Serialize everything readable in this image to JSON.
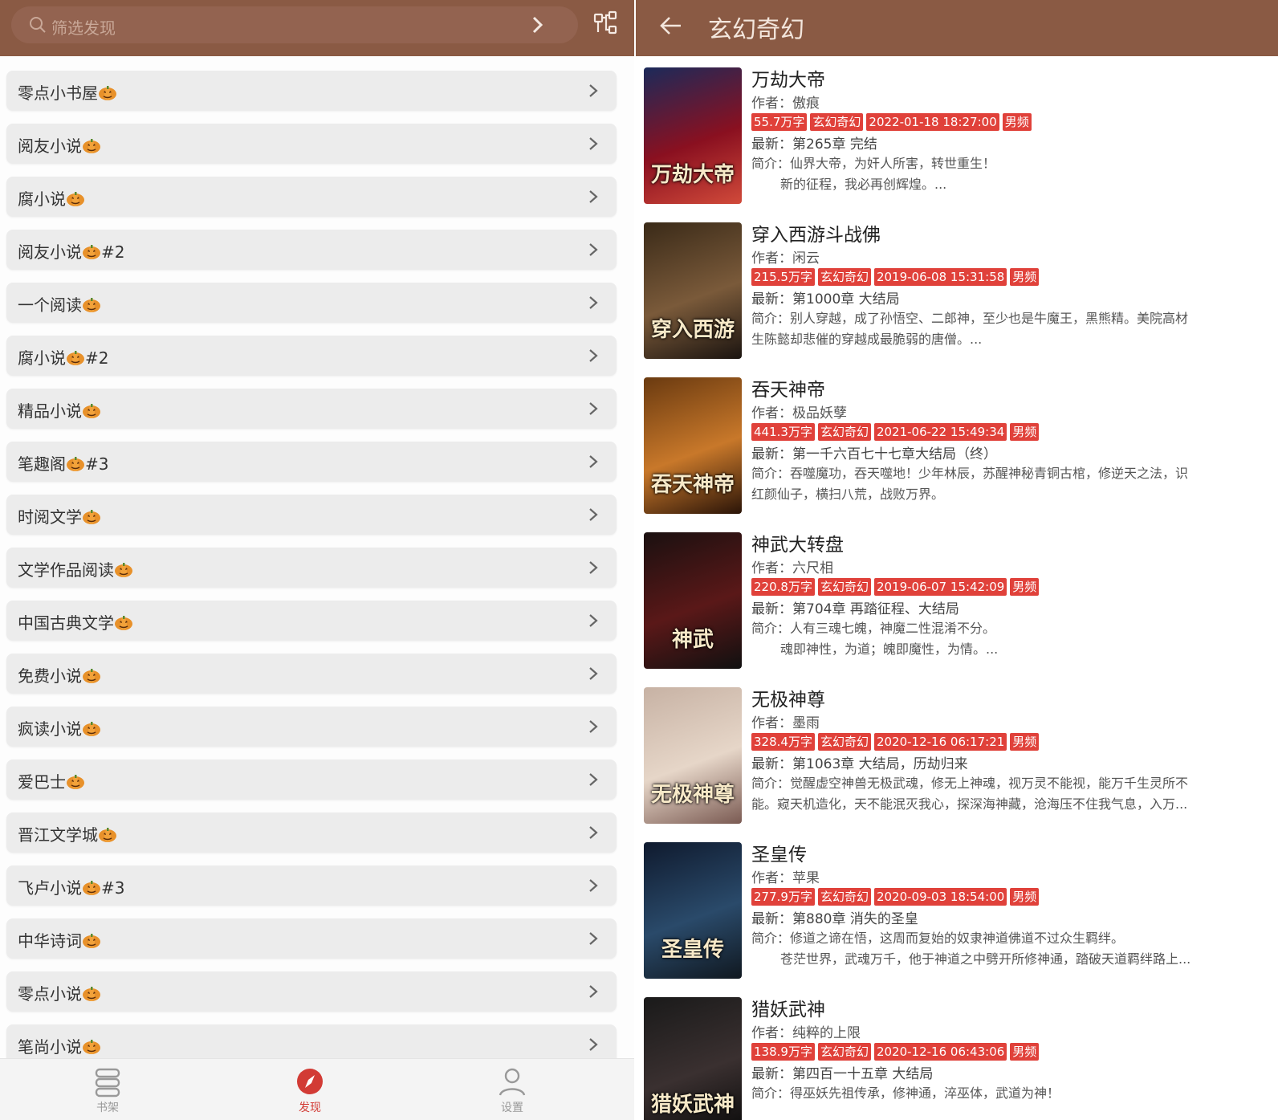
{
  "left": {
    "search_placeholder": "筛选发现",
    "sources": [
      {
        "name": "零点小书屋",
        "suffix": ""
      },
      {
        "name": "阅友小说",
        "suffix": ""
      },
      {
        "name": "腐小说",
        "suffix": ""
      },
      {
        "name": "阅友小说",
        "suffix": "#2"
      },
      {
        "name": "一个阅读",
        "suffix": ""
      },
      {
        "name": "腐小说",
        "suffix": "#2"
      },
      {
        "name": "精品小说",
        "suffix": ""
      },
      {
        "name": "笔趣阁",
        "suffix": "#3"
      },
      {
        "name": "时阅文学",
        "suffix": ""
      },
      {
        "name": "文学作品阅读",
        "suffix": ""
      },
      {
        "name": "中国古典文学",
        "suffix": ""
      },
      {
        "name": "免费小说",
        "suffix": ""
      },
      {
        "name": "疯读小说",
        "suffix": ""
      },
      {
        "name": "爱巴士",
        "suffix": ""
      },
      {
        "name": "晋江文学城",
        "suffix": ""
      },
      {
        "name": "飞卢小说",
        "suffix": "#3"
      },
      {
        "name": "中华诗词",
        "suffix": ""
      },
      {
        "name": "零点小说",
        "suffix": ""
      },
      {
        "name": "笔尚小说",
        "suffix": ""
      }
    ],
    "nav": {
      "bookshelf": "书架",
      "discover": "发现",
      "settings": "设置"
    },
    "accent": "#8a5a44",
    "active_color": "#d23b35"
  },
  "right": {
    "title": "玄幻奇幻",
    "tag_color": "#e0413a",
    "books": [
      {
        "name": "万劫大帝",
        "author": "作者：傲痕",
        "words": "55.7万字",
        "category": "玄幻奇幻",
        "updated": "2022-01-18 18:27:00",
        "channel": "男频",
        "latest": "最新：第265章 完结",
        "intro1": "简介：仙界大帝，为奸人所害，转世重生！",
        "intro2": "新的征程，我必再创辉煌。...",
        "cover_text": "万劫大帝"
      },
      {
        "name": "穿入西游斗战佛",
        "author": "作者：闲云",
        "words": "215.5万字",
        "category": "玄幻奇幻",
        "updated": "2019-06-08 15:31:58",
        "channel": "男频",
        "latest": "最新：第1000章 大结局",
        "intro1": "简介：别人穿越，成了孙悟空、二郎神，至少也是牛魔王，黑熊精。美院高材",
        "intro2": "生陈懿却悲催的穿越成最脆弱的唐僧。...",
        "cover_text": "穿入西游"
      },
      {
        "name": "吞天神帝",
        "author": "作者：极品妖孽",
        "words": "441.3万字",
        "category": "玄幻奇幻",
        "updated": "2021-06-22 15:49:34",
        "channel": "男频",
        "latest": "最新：第一千六百七十七章大结局（终）",
        "intro1": "简介：吞噬魔功，吞天噬地！少年林辰，苏醒神秘青铜古棺，修逆天之法，识",
        "intro2": "红颜仙子，横扫八荒，战败万界。",
        "cover_text": "吞天神帝"
      },
      {
        "name": "神武大转盘",
        "author": "作者：六尺相",
        "words": "220.8万字",
        "category": "玄幻奇幻",
        "updated": "2019-06-07 15:42:09",
        "channel": "男频",
        "latest": "最新：第704章 再踏征程、大结局",
        "intro1": "简介：人有三魂七魄，神魔二性混淆不分。",
        "intro2": "魂即神性，为道；魄即魔性，为情。...",
        "cover_text": "神武"
      },
      {
        "name": "无极神尊",
        "author": "作者：墨雨",
        "words": "328.4万字",
        "category": "玄幻奇幻",
        "updated": "2020-12-16 06:17:21",
        "channel": "男频",
        "latest": "最新：第1063章 大结局，历劫归来",
        "intro1": "简介：觉醒虚空神兽无极武魂，修无上神魂，视万灵不能视，能万千生灵所不",
        "intro2": "能。窥天机造化，天不能泯灭我心，探深海神藏，沧海压不住我气息，入万...",
        "cover_text": "无极神尊"
      },
      {
        "name": "圣皇传",
        "author": "作者：苹果",
        "words": "277.9万字",
        "category": "玄幻奇幻",
        "updated": "2020-09-03 18:54:00",
        "channel": "男频",
        "latest": "最新：第880章 消失的圣皇",
        "intro1": "简介：修道之谛在悟，这周而复始的奴隶神道佛道不过众生羁绊。",
        "intro2": "苍茫世界，武魂万千，他于神道之中劈开所修神通，踏破天道羁绊路上...",
        "cover_text": "圣皇传"
      },
      {
        "name": "猎妖武神",
        "author": "作者：纯粹的上限",
        "words": "138.9万字",
        "category": "玄幻奇幻",
        "updated": "2020-12-16 06:43:06",
        "channel": "男频",
        "latest": "最新：第四百一十五章 大结局",
        "intro1": "简介：得巫妖先祖传承，修神通，淬巫体，武道为神！",
        "intro2": "",
        "cover_text": "猎妖武神"
      }
    ]
  }
}
